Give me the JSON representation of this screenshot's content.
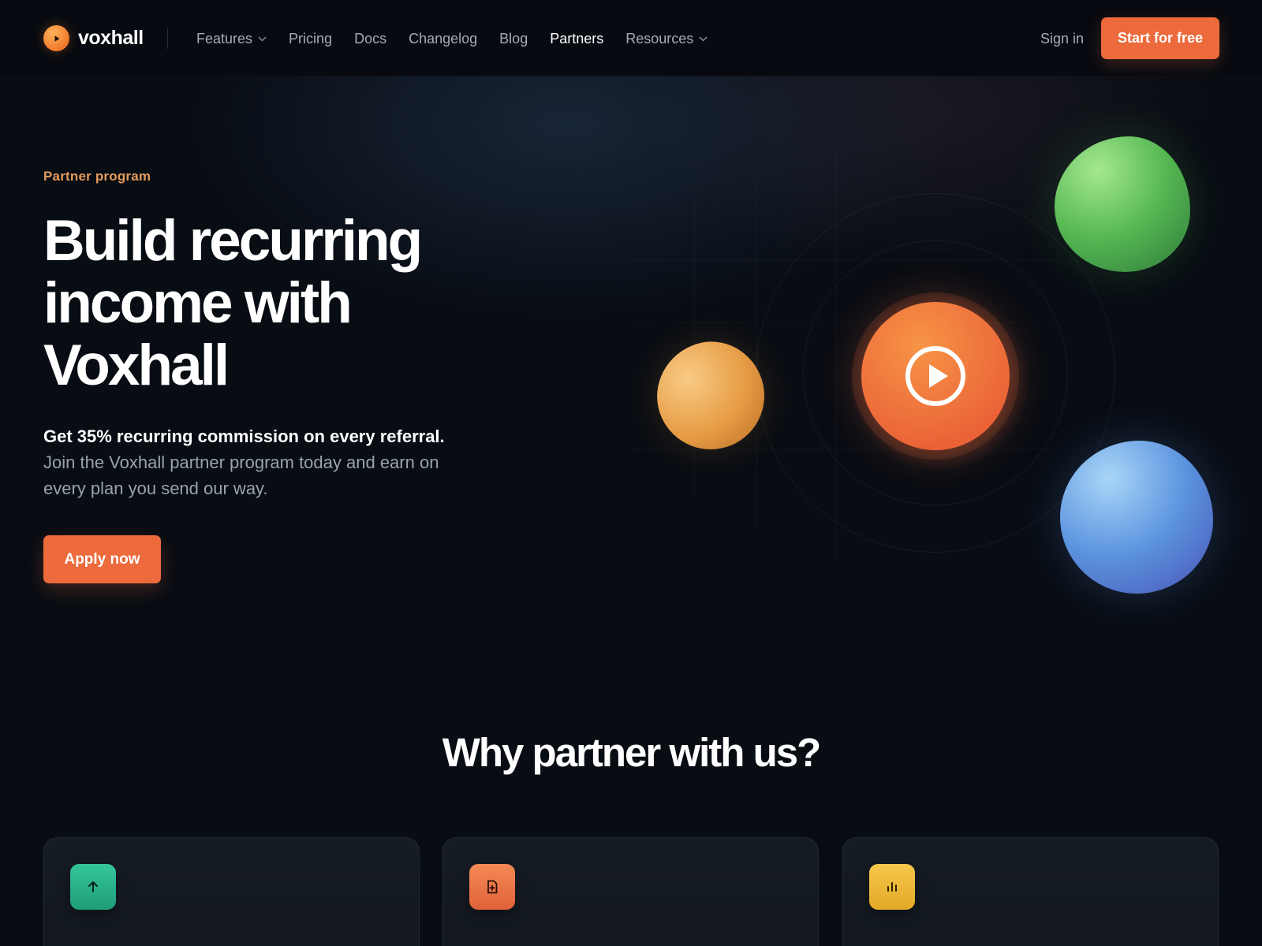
{
  "brand": {
    "name": "voxhall",
    "accent": "#ec6a3c"
  },
  "nav": {
    "items": [
      {
        "label": "Features",
        "dropdown": true,
        "active": false
      },
      {
        "label": "Pricing",
        "dropdown": false,
        "active": false
      },
      {
        "label": "Docs",
        "dropdown": false,
        "active": false
      },
      {
        "label": "Changelog",
        "dropdown": false,
        "active": false
      },
      {
        "label": "Blog",
        "dropdown": false,
        "active": false
      },
      {
        "label": "Partners",
        "dropdown": false,
        "active": true
      },
      {
        "label": "Resources",
        "dropdown": true,
        "active": false
      }
    ],
    "sign_in": "Sign in",
    "cta": "Start for free"
  },
  "hero": {
    "eyebrow": "Partner program",
    "title": "Build recurring income with Voxhall",
    "lead_strong": "Get 35% recurring commission on every referral.",
    "lead_rest": " Join the Voxhall partner program today and earn on every plan you send our way.",
    "cta": "Apply now",
    "eyebrow_color": "#e39a5b"
  },
  "why": {
    "title": "Why partner with us?",
    "cards": [
      {
        "icon": "arrow-up-icon",
        "color": "#2bb38a"
      },
      {
        "icon": "document-plus-icon",
        "color": "#ec6a3c"
      },
      {
        "icon": "bar-chart-icon",
        "color": "#f0b83a"
      }
    ]
  }
}
